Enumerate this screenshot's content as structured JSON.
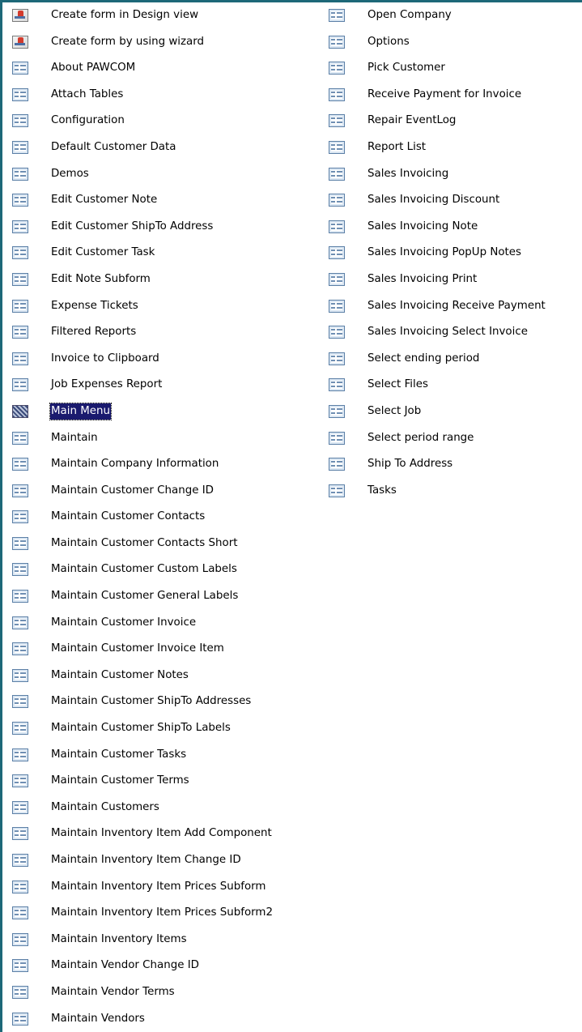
{
  "left_column": [
    {
      "label": "Create form in Design view",
      "icon": "design-view-icon"
    },
    {
      "label": "Create form by using wizard",
      "icon": "form-wizard-icon"
    },
    {
      "label": "About PAWCOM",
      "icon": "form-icon"
    },
    {
      "label": "Attach Tables",
      "icon": "form-icon"
    },
    {
      "label": "Configuration",
      "icon": "form-icon"
    },
    {
      "label": "Default Customer Data",
      "icon": "form-icon"
    },
    {
      "label": "Demos",
      "icon": "form-icon"
    },
    {
      "label": "Edit Customer Note",
      "icon": "form-icon"
    },
    {
      "label": "Edit Customer ShipTo Address",
      "icon": "form-icon"
    },
    {
      "label": "Edit Customer Task",
      "icon": "form-icon"
    },
    {
      "label": "Edit Note Subform",
      "icon": "form-icon"
    },
    {
      "label": "Expense Tickets",
      "icon": "form-icon"
    },
    {
      "label": "Filtered Reports",
      "icon": "form-icon"
    },
    {
      "label": "Invoice to Clipboard",
      "icon": "form-icon"
    },
    {
      "label": "Job Expenses Report",
      "icon": "form-icon"
    },
    {
      "label": "Main Menu",
      "icon": "form-icon",
      "selected": true
    },
    {
      "label": "Maintain",
      "icon": "form-icon"
    },
    {
      "label": "Maintain Company Information",
      "icon": "form-icon"
    },
    {
      "label": "Maintain Customer Change ID",
      "icon": "form-icon"
    },
    {
      "label": "Maintain Customer Contacts",
      "icon": "form-icon"
    },
    {
      "label": "Maintain Customer Contacts Short",
      "icon": "form-icon"
    },
    {
      "label": "Maintain Customer Custom Labels",
      "icon": "form-icon"
    },
    {
      "label": "Maintain Customer General Labels",
      "icon": "form-icon"
    },
    {
      "label": "Maintain Customer Invoice",
      "icon": "form-icon"
    },
    {
      "label": "Maintain Customer Invoice Item",
      "icon": "form-icon"
    },
    {
      "label": "Maintain Customer Notes",
      "icon": "form-icon"
    },
    {
      "label": "Maintain Customer ShipTo Addresses",
      "icon": "form-icon"
    },
    {
      "label": "Maintain Customer ShipTo Labels",
      "icon": "form-icon"
    },
    {
      "label": "Maintain Customer Tasks",
      "icon": "form-icon"
    },
    {
      "label": "Maintain Customer Terms",
      "icon": "form-icon"
    },
    {
      "label": "Maintain Customers",
      "icon": "form-icon"
    },
    {
      "label": "Maintain Inventory Item Add Component",
      "icon": "form-icon"
    },
    {
      "label": "Maintain Inventory Item Change ID",
      "icon": "form-icon"
    },
    {
      "label": "Maintain Inventory Item Prices Subform",
      "icon": "form-icon"
    },
    {
      "label": "Maintain Inventory Item Prices Subform2",
      "icon": "form-icon"
    },
    {
      "label": "Maintain Inventory Items",
      "icon": "form-icon"
    },
    {
      "label": "Maintain Vendor Change ID",
      "icon": "form-icon"
    },
    {
      "label": "Maintain Vendor Terms",
      "icon": "form-icon"
    },
    {
      "label": "Maintain Vendors",
      "icon": "form-icon"
    }
  ],
  "right_column": [
    {
      "label": "Open Company",
      "icon": "form-icon"
    },
    {
      "label": "Options",
      "icon": "form-icon"
    },
    {
      "label": "Pick Customer",
      "icon": "form-icon"
    },
    {
      "label": "Receive Payment for Invoice",
      "icon": "form-icon"
    },
    {
      "label": "Repair EventLog",
      "icon": "form-icon"
    },
    {
      "label": "Report List",
      "icon": "form-icon"
    },
    {
      "label": "Sales Invoicing",
      "icon": "form-icon"
    },
    {
      "label": "Sales Invoicing Discount",
      "icon": "form-icon"
    },
    {
      "label": "Sales Invoicing Note",
      "icon": "form-icon"
    },
    {
      "label": "Sales Invoicing PopUp Notes",
      "icon": "form-icon"
    },
    {
      "label": "Sales Invoicing Print",
      "icon": "form-icon"
    },
    {
      "label": "Sales Invoicing Receive Payment",
      "icon": "form-icon"
    },
    {
      "label": "Sales Invoicing Select Invoice",
      "icon": "form-icon"
    },
    {
      "label": "Select ending period",
      "icon": "form-icon"
    },
    {
      "label": "Select Files",
      "icon": "form-icon"
    },
    {
      "label": "Select Job",
      "icon": "form-icon"
    },
    {
      "label": "Select period range",
      "icon": "form-icon"
    },
    {
      "label": "Ship To Address",
      "icon": "form-icon"
    },
    {
      "label": "Tasks",
      "icon": "form-icon"
    }
  ],
  "colors": {
    "frame_border": "#1d6878",
    "selection_background": "#1a1a6e",
    "selection_text": "#ffffff"
  }
}
